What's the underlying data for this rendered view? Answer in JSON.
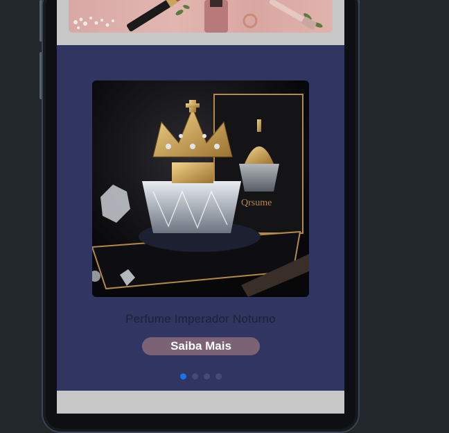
{
  "carousel": {
    "product_title": "Perfume Imperador Noturno",
    "button_label": "Saiba Mais",
    "slide_count": 4,
    "active_slide": 1
  },
  "colors": {
    "carousel_bg": "#303561",
    "button_bg": "#7c6275",
    "active_dot": "#1a73e8",
    "inactive_dot": "#454b72",
    "page_bg": "#c7c7c7"
  },
  "icons": {
    "product_image": "crown-perfume-bottle",
    "top_banner": "cosmetics-flatlay"
  }
}
